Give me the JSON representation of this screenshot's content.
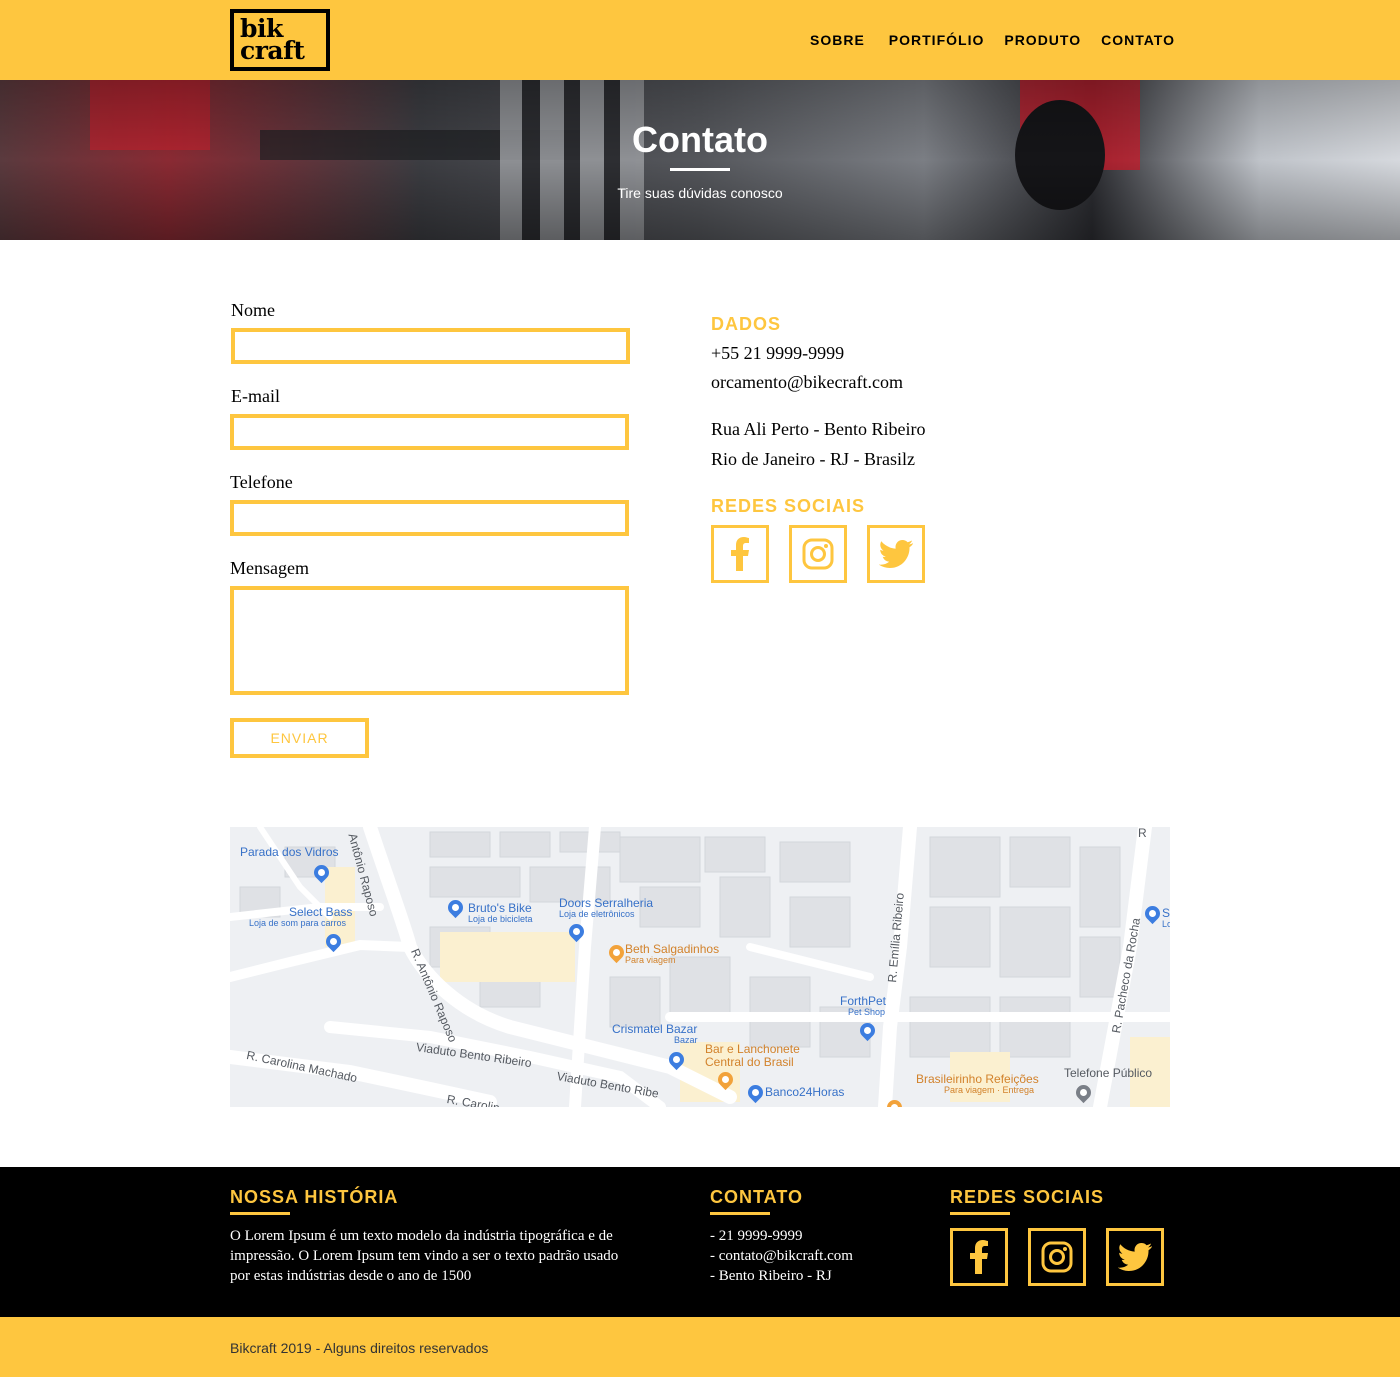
{
  "header": {
    "logo_line1": "bik",
    "logo_line2": "craft",
    "nav": [
      "SOBRE",
      "PORTIFÓLIO",
      "PRODUTO",
      "CONTATO"
    ]
  },
  "hero": {
    "title": "Contato",
    "subtitle": "Tire suas dúvidas conosco"
  },
  "form": {
    "name_label": "Nome",
    "email_label": "E-mail",
    "phone_label": "Telefone",
    "message_label": "Mensagem",
    "submit_label": "ENVIAR"
  },
  "contact": {
    "data_title": "DADOS",
    "phone": "+55 21 9999-9999",
    "email": "orcamento@bikecraft.com",
    "address_line1": "Rua Ali Perto - Bento Ribeiro",
    "address_line2": "Rio de Janeiro - RJ - Brasilz",
    "social_title": "REDES SOCIAIS",
    "social_icons": [
      "facebook-icon",
      "instagram-icon",
      "twitter-icon"
    ]
  },
  "map": {
    "streets": [
      "Antônio Raposo",
      "R. Antônio Raposo",
      "Viaduto Bento Ribeiro",
      "Viaduto Bento Ribe",
      "R. Carolina Machado",
      "R. Carolin",
      "R. Emília Ribeiro",
      "R. Pacheco da Rocha",
      "R"
    ],
    "places": [
      {
        "name": "Parada dos Vidros",
        "sub": ""
      },
      {
        "name": "Select Bass",
        "sub": "Loja de som para carros"
      },
      {
        "name": "Bruto's Bike",
        "sub": "Loja de bicicleta"
      },
      {
        "name": "Doors Serralheria",
        "sub": "Loja de eletrônicos"
      },
      {
        "name": "Beth Salgadinhos",
        "sub": "Para viagem"
      },
      {
        "name": "ForthPet",
        "sub": "Pet Shop"
      },
      {
        "name": "Crismatel Bazar",
        "sub": "Bazar"
      },
      {
        "name": "Bar e Lanchonete Central do Brasil",
        "sub": ""
      },
      {
        "name": "Banco24Horas",
        "sub": ""
      },
      {
        "name": "Brasileirinho Refeições",
        "sub": "Para viagem · Entrega"
      },
      {
        "name": "Telefone Público",
        "sub": ""
      },
      {
        "name": "S",
        "sub": "Lo"
      }
    ]
  },
  "footer": {
    "history_title": "NOSSA HISTÓRIA",
    "history_lines": [
      "O Lorem Ipsum é um texto modelo da indústria tipográfica e de",
      "impressão. O Lorem Ipsum tem vindo a ser o texto padrão usado",
      "por estas indústrias desde o ano de 1500"
    ],
    "contact_title": "CONTATO",
    "contact_lines": [
      "- 21 9999-9999",
      "- contato@bikcraft.com",
      "- Bento Ribeiro - RJ"
    ],
    "social_title": "REDES SOCIAIS",
    "copyright": "Bikcraft 2019 - Alguns direitos reservados"
  },
  "colors": {
    "accent": "#fec63f",
    "footer_bg": "#000000"
  }
}
